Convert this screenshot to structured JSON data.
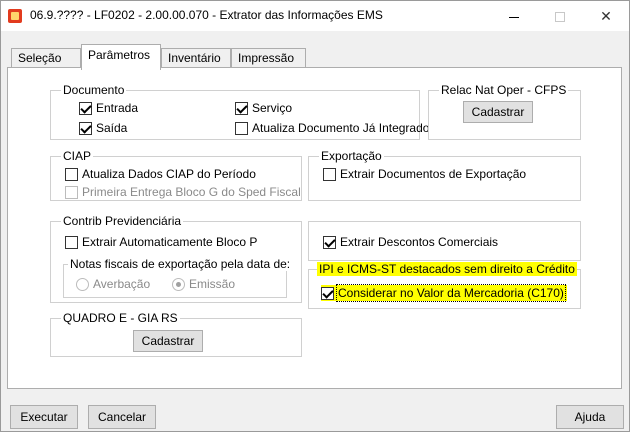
{
  "window": {
    "title": "06.9.???? - LF0202 - 2.00.00.070 - Extrator das Informações EMS"
  },
  "tabs": [
    "Seleção",
    "Parâmetros",
    "Inventário",
    "Impressão"
  ],
  "documento": {
    "title": "Documento",
    "entrada": "Entrada",
    "saida": "Saída",
    "servico": "Serviço",
    "atualiza": "Atualiza Documento Já Integrado"
  },
  "relac": {
    "title": "Relac Nat Oper - CFPS",
    "button": "Cadastrar"
  },
  "ciap": {
    "title": "CIAP",
    "atualiza": "Atualiza Dados CIAP do Período",
    "primeira": "Primeira Entrega Bloco G do Sped Fiscal"
  },
  "exportacao": {
    "title": "Exportação",
    "extrair": "Extrair Documentos de Exportação"
  },
  "contrib": {
    "title": "Contrib Previdenciária",
    "extrair": "Extrair Automaticamente Bloco P",
    "notas_title": "Notas fiscais de exportação pela data de:",
    "averbacao": "Averbação",
    "emissao": "Emissão"
  },
  "descontos": {
    "label": "Extrair Descontos Comerciais"
  },
  "ipi": {
    "title": "IPI e ICMS-ST destacados sem direito a Crédito",
    "considerar": "Considerar no Valor da Mercadoria (C170)"
  },
  "quadro": {
    "title": "QUADRO E - GIA RS",
    "button": "Cadastrar"
  },
  "footer": {
    "executar": "Executar",
    "cancelar": "Cancelar",
    "ajuda": "Ajuda"
  }
}
